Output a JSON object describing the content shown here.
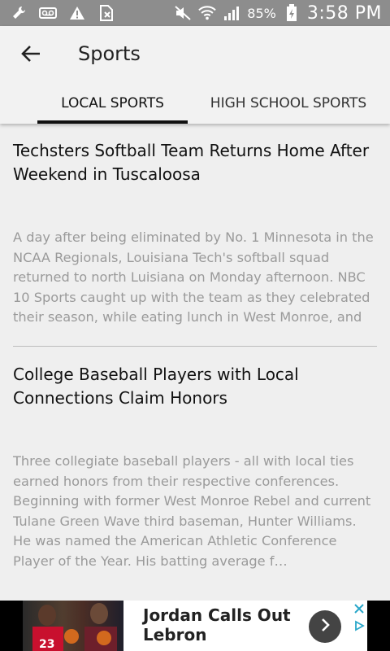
{
  "status_bar": {
    "battery": "85%",
    "time": "3:58 PM",
    "icons": [
      "wrench-icon",
      "voicemail-icon",
      "warning-icon",
      "sim-icon",
      "mute-icon",
      "wifi-icon",
      "signal-icon",
      "battery-charging-icon"
    ]
  },
  "header": {
    "title": "Sports",
    "back_icon": "arrow-left-icon"
  },
  "tabs": [
    {
      "label": "LOCAL SPORTS",
      "active": true
    },
    {
      "label": "HIGH SCHOOL SPORTS",
      "active": false
    }
  ],
  "articles": [
    {
      "headline": "Techsters Softball Team Returns Home After Weekend in Tuscaloosa",
      "snippet": "A day after being eliminated by No. 1 Minnesota in the NCAA Regionals, Louisiana Tech's softball squad returned to north Luisiana on Monday afternoon. NBC 10 Sports caught up with the team as they celebrated their season, while eating lunch in West Monroe, and asked them what they look forward to…"
    },
    {
      "headline": "College Baseball Players with Local Connections Claim Honors",
      "snippet": "Three collegiate baseball players - all with local ties earned honors from their respective conferences. Beginning with former West Monroe Rebel and current Tulane Green Wave third baseman, Hunter Williams. He was named the American Athletic Conference Player of the Year. His batting average f…"
    }
  ],
  "ad": {
    "text": "Jordan Calls Out Lebron",
    "icons": [
      "chevron-right-icon",
      "close-icon",
      "ad-choices-icon"
    ]
  }
}
